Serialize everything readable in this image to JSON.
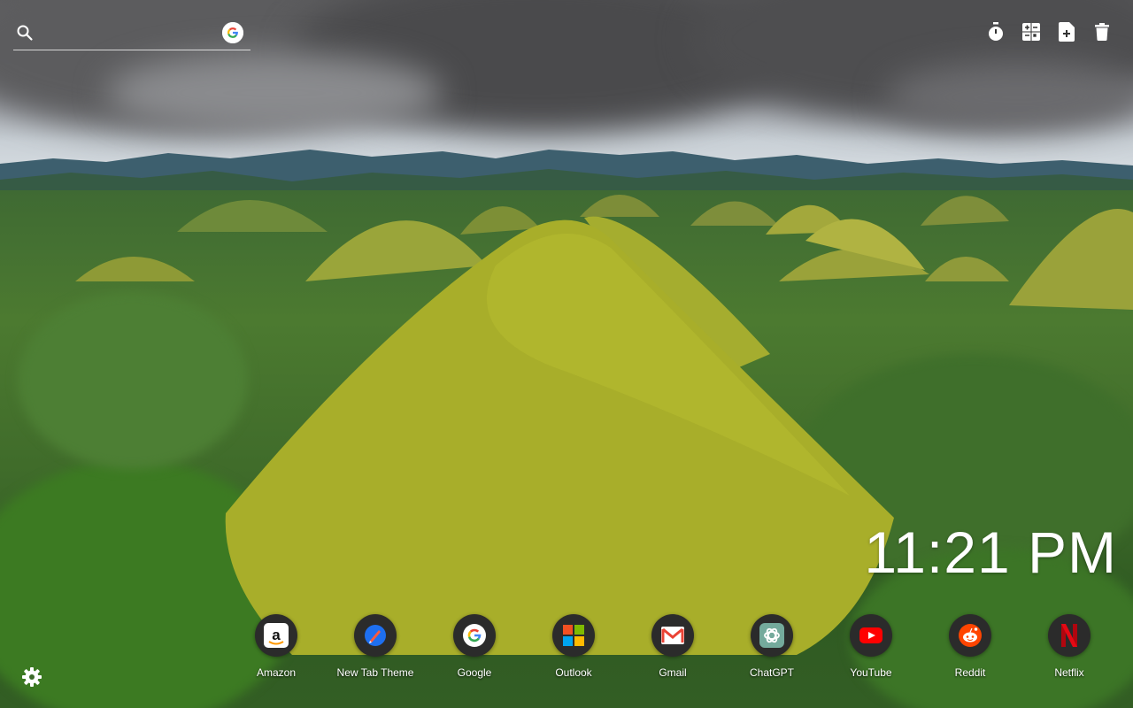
{
  "search": {
    "value": "",
    "placeholder": "",
    "icon": "search-icon",
    "engine_icon": "google-g-icon"
  },
  "toolbar": {
    "items": [
      {
        "icon": "stopwatch-icon"
      },
      {
        "icon": "calculator-icon"
      },
      {
        "icon": "add-note-icon"
      },
      {
        "icon": "trash-icon"
      }
    ]
  },
  "clock": {
    "time": "11:21 PM"
  },
  "shortcuts": [
    {
      "label": "Amazon",
      "icon": "amazon-icon"
    },
    {
      "label": "New Tab Theme",
      "icon": "new-tab-theme-icon"
    },
    {
      "label": "Google",
      "icon": "google-icon"
    },
    {
      "label": "Outlook",
      "icon": "outlook-icon"
    },
    {
      "label": "Gmail",
      "icon": "gmail-icon"
    },
    {
      "label": "ChatGPT",
      "icon": "chatgpt-icon"
    },
    {
      "label": "YouTube",
      "icon": "youtube-icon"
    },
    {
      "label": "Reddit",
      "icon": "reddit-icon"
    },
    {
      "label": "Netflix",
      "icon": "netflix-icon"
    }
  ],
  "settings": {
    "icon": "gear-icon"
  },
  "colors": {
    "text": "#ffffff",
    "icon_circle": "#2b2b2b",
    "hill": "#9aa82c"
  }
}
